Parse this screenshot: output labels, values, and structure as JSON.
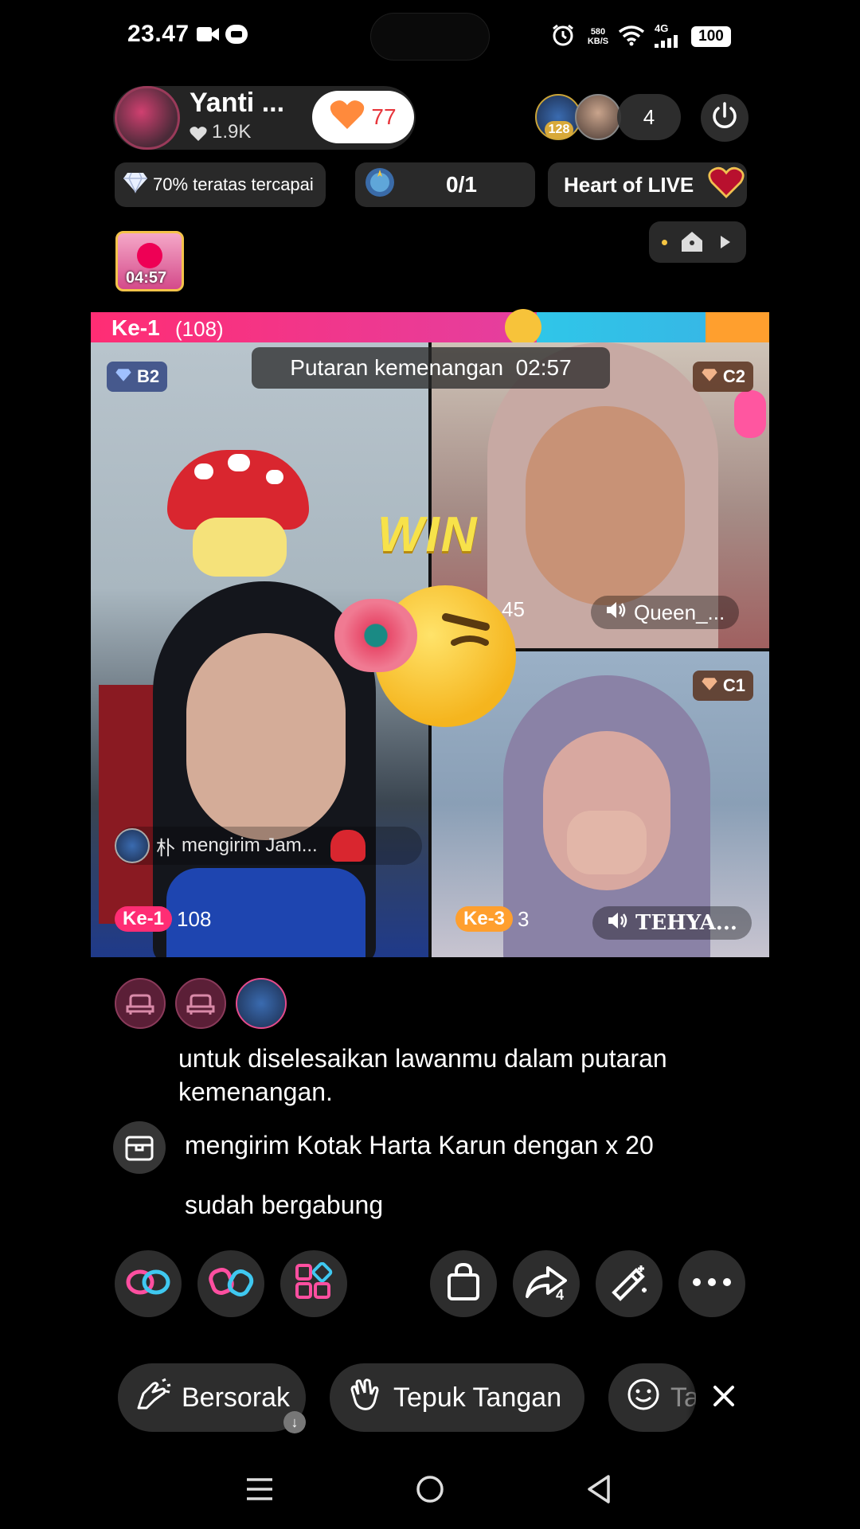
{
  "status_bar": {
    "time": "23.47",
    "net_speed_top": "580",
    "net_speed_bottom": "KB/S",
    "network": "4G",
    "battery": "100"
  },
  "host": {
    "name": "Yanti ...",
    "likes": "1.9K",
    "like_count": "77"
  },
  "viewers": {
    "badge_level": "128",
    "count": "4"
  },
  "chips": {
    "diamond_text": "70% teratas tercapai",
    "goal_text": "0/1",
    "heart_text": "Heart of LIVE"
  },
  "chest_timer": "04:57",
  "battle": {
    "leader_label": "Ke-1",
    "leader_score": "(108)",
    "round_label": "Putaran kemenangan",
    "round_time": "02:57",
    "win_text": "WIN",
    "tiles": [
      {
        "badge": "B2",
        "rank_label": "Ke-1",
        "score": "108",
        "gift_text": "mengirim Jam...",
        "gift_sender": "朴"
      },
      {
        "badge": "C2",
        "score": "45",
        "mic_name": "Queen_..."
      },
      {
        "badge": "C1",
        "rank_label": "Ke-3",
        "score": "3",
        "mic_name": "TEHYA..."
      }
    ]
  },
  "chat": [
    {
      "text": "untuk diselesaikan lawanmu dalam putaran kemenangan."
    },
    {
      "text": "mengirim Kotak Harta Karun dengan  x 20"
    },
    {
      "text": "sudah bergabung"
    }
  ],
  "actions": {
    "share_count": "4"
  },
  "reactions": [
    {
      "label": "Bersorak"
    },
    {
      "label": "Tepuk Tangan"
    },
    {
      "label": "Ta"
    }
  ],
  "colors": {
    "accent_pink": "#ff2d74",
    "leader_bar": "#e7307a",
    "opponent_bar": "#2fc6e8",
    "orange_bar": "#ff9f2e",
    "like_red": "#e7353b",
    "win_yellow": "#f7e24a"
  }
}
